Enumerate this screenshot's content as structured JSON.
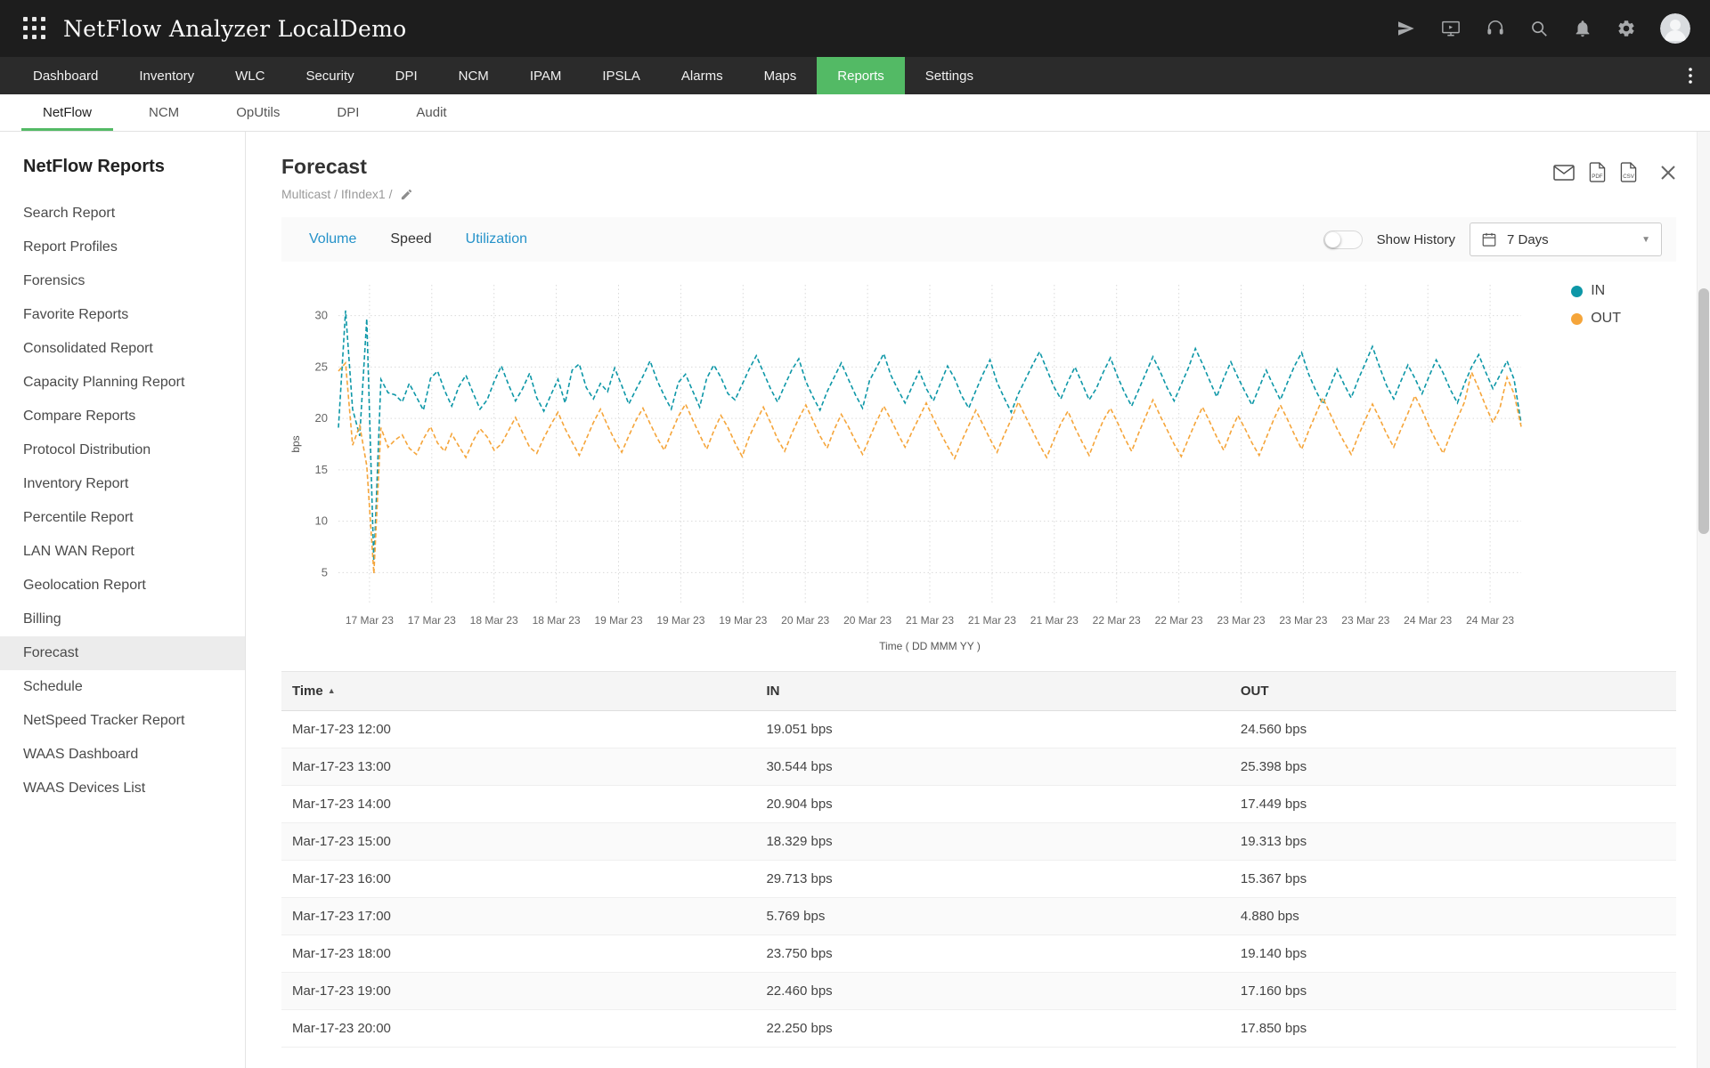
{
  "app": {
    "title": "NetFlow Analyzer LocalDemo"
  },
  "colors": {
    "accent_green": "#53ba65",
    "link_blue": "#2592c9",
    "series_in": "#0d97a7",
    "series_out": "#f5a53a"
  },
  "header_icons": [
    "apps-grid",
    "launch",
    "demo-screen",
    "support-headset",
    "search",
    "notifications-bell",
    "settings-gear",
    "user-avatar"
  ],
  "nav": {
    "items": [
      "Dashboard",
      "Inventory",
      "WLC",
      "Security",
      "DPI",
      "NCM",
      "IPAM",
      "IPSLA",
      "Alarms",
      "Maps",
      "Reports",
      "Settings"
    ],
    "active": "Reports"
  },
  "subnav": {
    "items": [
      "NetFlow",
      "NCM",
      "OpUtils",
      "DPI",
      "Audit"
    ],
    "active": "NetFlow"
  },
  "sidebar": {
    "title": "NetFlow Reports",
    "items": [
      "Search Report",
      "Report Profiles",
      "Forensics",
      "Favorite Reports",
      "Consolidated Report",
      "Capacity Planning Report",
      "Compare Reports",
      "Protocol Distribution",
      "Inventory Report",
      "Percentile Report",
      "LAN WAN Report",
      "Geolocation Report",
      "Billing",
      "Forecast",
      "Schedule",
      "NetSpeed Tracker Report",
      "WAAS Dashboard",
      "WAAS Devices List"
    ],
    "active": "Forecast"
  },
  "report": {
    "title": "Forecast",
    "breadcrumb": "Multicast  /  IfIndex1  /",
    "tabs": [
      "Volume",
      "Speed",
      "Utilization"
    ],
    "active_tab": "Speed",
    "show_history": {
      "label": "Show History",
      "enabled": false
    },
    "period": "7 Days"
  },
  "chart_data": {
    "type": "line",
    "line_style": "dashed",
    "grid": true,
    "legend_position": "right",
    "ylabel": "bps",
    "xlabel": "Time ( DD MMM YY )",
    "ylim": [
      2,
      33
    ],
    "yticks": [
      5,
      10,
      15,
      20,
      25,
      30
    ],
    "xticklabels": [
      "17 Mar 23",
      "17 Mar 23",
      "18 Mar 23",
      "18 Mar 23",
      "19 Mar 23",
      "19 Mar 23",
      "19 Mar 23",
      "20 Mar 23",
      "20 Mar 23",
      "21 Mar 23",
      "21 Mar 23",
      "21 Mar 23",
      "22 Mar 23",
      "22 Mar 23",
      "23 Mar 23",
      "23 Mar 23",
      "23 Mar 23",
      "24 Mar 23",
      "24 Mar 23"
    ],
    "series": [
      {
        "name": "IN",
        "color": "#0d97a7",
        "values": [
          19.1,
          30.5,
          20.9,
          18.3,
          29.7,
          5.8,
          23.8,
          22.5,
          22.3,
          21.6,
          23.4,
          22.1,
          20.8,
          23.9,
          24.6,
          22.7,
          21.2,
          23.1,
          24.2,
          22.5,
          20.9,
          21.8,
          23.6,
          25.1,
          23.3,
          21.7,
          22.9,
          24.4,
          22.0,
          20.7,
          22.3,
          23.8,
          21.5,
          24.7,
          25.3,
          23.0,
          21.9,
          23.4,
          22.6,
          24.9,
          23.2,
          21.4,
          22.8,
          24.1,
          25.6,
          23.7,
          22.2,
          20.9,
          23.5,
          24.3,
          22.7,
          21.1,
          23.9,
          25.2,
          24.0,
          22.4,
          21.8,
          23.3,
          24.8,
          26.1,
          24.5,
          22.9,
          21.6,
          23.2,
          24.7,
          25.8,
          23.6,
          22.1,
          20.8,
          22.6,
          24.0,
          25.4,
          23.8,
          22.3,
          21.0,
          23.7,
          25.0,
          26.3,
          24.2,
          22.8,
          21.5,
          23.1,
          24.6,
          22.9,
          21.7,
          23.4,
          25.1,
          23.9,
          22.2,
          21.0,
          22.7,
          24.3,
          25.7,
          23.5,
          22.0,
          20.6,
          22.4,
          23.8,
          25.2,
          26.5,
          24.8,
          23.1,
          21.9,
          23.6,
          25.0,
          23.4,
          21.8,
          22.9,
          24.5,
          25.9,
          24.1,
          22.5,
          21.2,
          22.8,
          24.4,
          26.0,
          24.6,
          23.0,
          21.7,
          23.3,
          24.9,
          26.8,
          25.3,
          23.7,
          22.1,
          23.9,
          25.5,
          24.0,
          22.6,
          21.3,
          23.0,
          24.7,
          23.2,
          21.8,
          23.5,
          25.1,
          26.4,
          24.3,
          22.7,
          21.4,
          23.1,
          24.8,
          23.3,
          22.0,
          23.8,
          25.4,
          27.0,
          25.0,
          23.2,
          21.9,
          23.6,
          25.2,
          23.9,
          22.4,
          24.1,
          25.7,
          24.4,
          22.8,
          21.5,
          23.4,
          25.0,
          26.2,
          24.5,
          22.9,
          24.2,
          25.6,
          23.8,
          19.5
        ]
      },
      {
        "name": "OUT",
        "color": "#f5a53a",
        "values": [
          24.6,
          25.4,
          17.4,
          19.3,
          15.4,
          4.9,
          19.1,
          17.2,
          17.9,
          18.4,
          17.1,
          16.5,
          18.0,
          19.2,
          17.6,
          16.8,
          18.5,
          17.3,
          16.2,
          17.8,
          19.0,
          18.2,
          16.9,
          17.5,
          18.8,
          20.1,
          18.6,
          17.2,
          16.6,
          18.1,
          19.4,
          20.6,
          19.0,
          17.7,
          16.4,
          18.0,
          19.6,
          20.9,
          19.3,
          17.9,
          16.7,
          18.3,
          19.8,
          21.0,
          19.5,
          18.1,
          16.9,
          18.6,
          20.2,
          21.4,
          19.9,
          18.4,
          17.0,
          18.8,
          20.3,
          19.1,
          17.6,
          16.3,
          18.2,
          19.7,
          21.1,
          19.6,
          18.0,
          16.8,
          18.5,
          20.0,
          21.3,
          19.8,
          18.3,
          17.1,
          18.9,
          20.4,
          19.2,
          17.8,
          16.5,
          18.1,
          19.7,
          21.2,
          19.9,
          18.5,
          17.2,
          18.7,
          20.1,
          21.5,
          20.0,
          18.6,
          17.3,
          16.1,
          17.8,
          19.3,
          20.8,
          19.4,
          18.0,
          16.7,
          18.4,
          19.9,
          21.6,
          20.2,
          18.8,
          17.4,
          16.2,
          17.9,
          19.5,
          20.7,
          19.1,
          17.7,
          16.4,
          18.2,
          19.8,
          21.0,
          19.6,
          18.1,
          16.8,
          18.6,
          20.2,
          21.8,
          20.3,
          18.9,
          17.5,
          16.3,
          18.0,
          19.6,
          21.1,
          19.7,
          18.2,
          16.9,
          18.7,
          20.3,
          19.0,
          17.6,
          16.4,
          18.1,
          19.8,
          21.3,
          19.9,
          18.4,
          17.0,
          18.8,
          20.4,
          22.0,
          20.5,
          19.0,
          17.7,
          16.5,
          18.3,
          19.9,
          21.4,
          20.0,
          18.5,
          17.2,
          18.9,
          20.5,
          22.2,
          20.8,
          19.2,
          17.8,
          16.6,
          18.4,
          20.0,
          21.6,
          24.5,
          22.9,
          21.2,
          19.6,
          21.0,
          24.0,
          22.4,
          19.2
        ]
      }
    ]
  },
  "table": {
    "columns": [
      "Time",
      "IN",
      "OUT"
    ],
    "rows": [
      [
        "Mar-17-23 12:00",
        "19.051 bps",
        "24.560 bps"
      ],
      [
        "Mar-17-23 13:00",
        "30.544 bps",
        "25.398 bps"
      ],
      [
        "Mar-17-23 14:00",
        "20.904 bps",
        "17.449 bps"
      ],
      [
        "Mar-17-23 15:00",
        "18.329 bps",
        "19.313 bps"
      ],
      [
        "Mar-17-23 16:00",
        "29.713 bps",
        "15.367 bps"
      ],
      [
        "Mar-17-23 17:00",
        "5.769 bps",
        "4.880 bps"
      ],
      [
        "Mar-17-23 18:00",
        "23.750 bps",
        "19.140 bps"
      ],
      [
        "Mar-17-23 19:00",
        "22.460 bps",
        "17.160 bps"
      ],
      [
        "Mar-17-23 20:00",
        "22.250 bps",
        "17.850 bps"
      ]
    ]
  }
}
